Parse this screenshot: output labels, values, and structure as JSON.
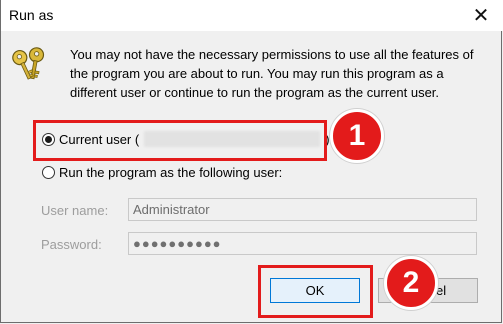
{
  "window": {
    "title": "Run as",
    "close_glyph": "✕"
  },
  "message": "You may not have the necessary permissions to use all the features of the program you are about to run. You may run this program as a different user or continue to run the program as the current user.",
  "options": {
    "current_user_prefix": "Current user (",
    "current_user_suffix": ")",
    "current_user_selected": true,
    "other_user_label": "Run the program as the following user:",
    "other_user_selected": false
  },
  "fields": {
    "username_label": "User name:",
    "username_value": "Administrator",
    "password_label": "Password:",
    "password_value": "●●●●●●●●●●"
  },
  "buttons": {
    "ok_label": "OK",
    "cancel_label": "Cancel",
    "cancel_visible_text": "el"
  },
  "callouts": {
    "step1": "1",
    "step2": "2"
  },
  "colors": {
    "highlight": "#e31b1b",
    "accent": "#0078d7"
  },
  "icons": {
    "dialog_icon": "keys-icon",
    "close": "close-icon"
  }
}
